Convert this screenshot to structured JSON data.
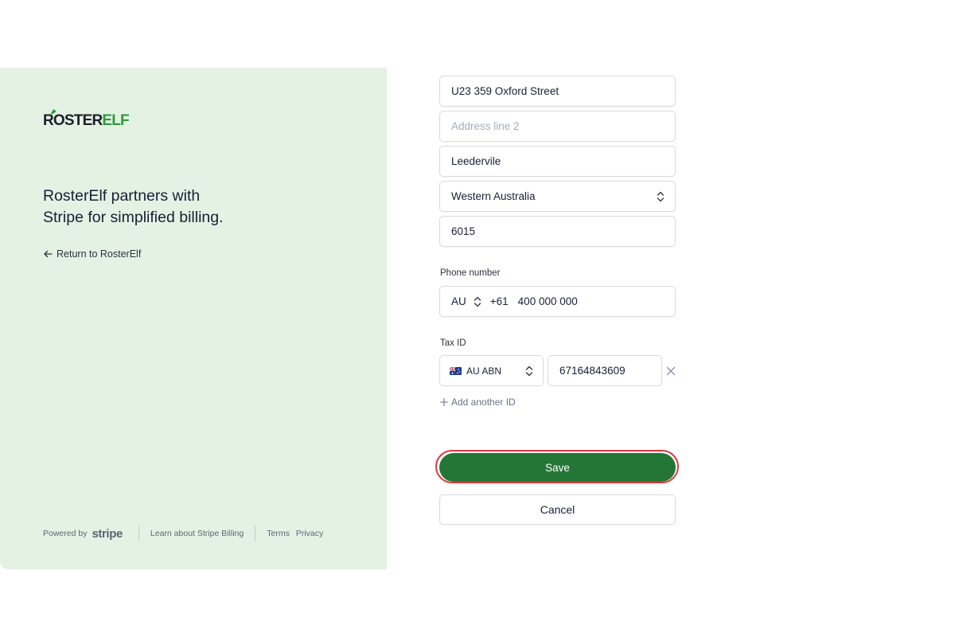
{
  "brand": {
    "logo_part1": "ROSTER",
    "logo_part2": "ELF",
    "tagline_line1": "RosterElf partners with",
    "tagline_line2": "Stripe for simplified billing.",
    "return_label": "Return to RosterElf",
    "accent_color": "#2e9a3d"
  },
  "footer": {
    "powered_by": "Powered by",
    "stripe_word": "stripe",
    "learn_link": "Learn about Stripe Billing",
    "terms_link": "Terms",
    "privacy_link": "Privacy"
  },
  "address": {
    "line1": "U23 359 Oxford Street",
    "line2_placeholder": "Address line 2",
    "city": "Leedervile",
    "state": "Western Australia",
    "postcode": "6015"
  },
  "phone": {
    "label": "Phone number",
    "country": "AU",
    "dial_code": "+61",
    "number": "400 000 000"
  },
  "tax": {
    "label": "Tax ID",
    "type": "AU ABN",
    "value": "67164843609",
    "add_label": "Add another ID"
  },
  "actions": {
    "save_label": "Save",
    "cancel_label": "Cancel",
    "save_color": "#247636",
    "highlight_color": "#e0393e"
  },
  "icons": {
    "return": "arrow-left-icon",
    "select": "chevron-up-down-icon",
    "remove": "close-icon",
    "add": "plus-icon",
    "flag": "australia-flag-icon"
  }
}
